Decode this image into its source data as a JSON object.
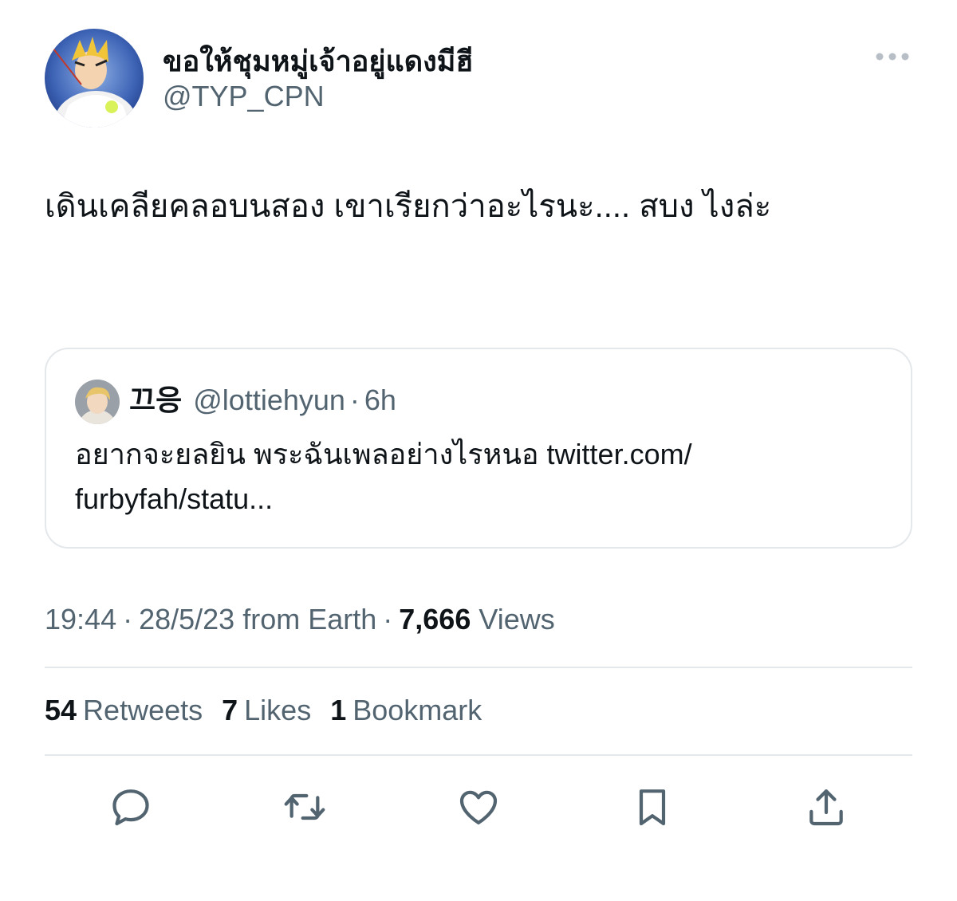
{
  "author": {
    "display_name": "ขอให้ชุมหมู่เจ้าอยู่แดงมีฮี",
    "handle": "@TYP_CPN"
  },
  "tweet": {
    "text": "เดินเคลียคลอบนสอง เขาเรียกว่าอะไรนะ.... สบง ไงล่ะ"
  },
  "quote": {
    "name": "끄응",
    "handle": "@lottiehyun",
    "separator": "·",
    "time": "6h",
    "text": "อยากจะยลยิน พระฉันเพลอย่างไรหนอ twitter.com/\nfurbyfah/statu..."
  },
  "meta": {
    "time": "19:44",
    "dot1": "·",
    "date_source": "28/5/23 from Earth",
    "dot2": "·",
    "views_count": "7,666",
    "views_label": "Views"
  },
  "stats": {
    "retweets_count": "54",
    "retweets_label": "Retweets",
    "likes_count": "7",
    "likes_label": "Likes",
    "bookmarks_count": "1",
    "bookmarks_label": "Bookmark"
  },
  "actions": [
    "reply-icon",
    "retweet-icon",
    "like-icon",
    "bookmark-icon",
    "share-icon"
  ],
  "colors": {
    "text_primary": "#0f1419",
    "text_secondary": "#536471",
    "divider": "#e4e8eb"
  }
}
